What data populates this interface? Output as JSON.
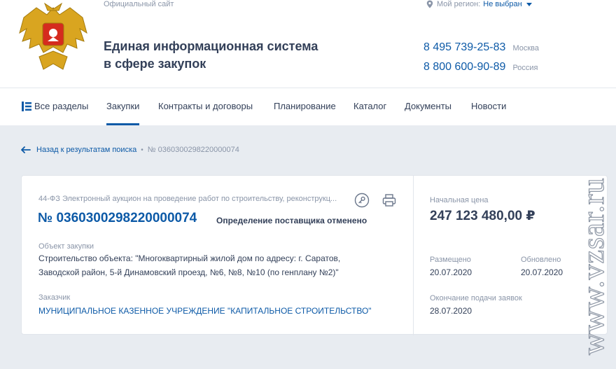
{
  "header": {
    "official_site": "Официальный сайт",
    "title_line1": "Единая информационная система",
    "title_line2": "в сфере закупок",
    "region_label": "Мой регион:",
    "region_value": "Не выбран",
    "phones": [
      {
        "number": "8 495 739-25-83",
        "city": "Москва"
      },
      {
        "number": "8 800 600-90-89",
        "city": "Россия"
      }
    ]
  },
  "nav": {
    "all_sections": "Все разделы",
    "items": [
      "Закупки",
      "Контракты и договоры",
      "Планирование",
      "Каталог",
      "Документы",
      "Новости"
    ],
    "active": "Закупки"
  },
  "breadcrumb": {
    "back": "Назад к результатам поиска",
    "separator": "•",
    "current": "№ 0360300298220000074"
  },
  "card": {
    "law": "44-ФЗ Электронный аукцион на проведение работ по строительству, реконструкц...",
    "number": "№ 0360300298220000074",
    "status": "Определение поставщика отменено",
    "object_label": "Объект закупки",
    "object_line1": "Строительство объекта: \"Многоквартирный жилой дом по адресу: г. Саратов,",
    "object_line2": "Заводской район, 5-й Динамовский проезд, №6, №8, №10 (по генплану №2)\"",
    "customer_label": "Заказчик",
    "customer": "МУНИЦИПАЛЬНОЕ КАЗЕННОЕ УЧРЕЖДЕНИЕ \"КАПИТАЛЬНОЕ СТРОИТЕЛЬСТВО\"",
    "price_label": "Начальная цена",
    "price": "247 123 480,00 ₽",
    "placed_label": "Размещено",
    "placed": "20.07.2020",
    "updated_label": "Обновлено",
    "updated": "20.07.2020",
    "deadline_label": "Окончание подачи заявок",
    "deadline": "28.07.2020"
  },
  "watermark": "www.vzsar.ru",
  "colors": {
    "accent": "#0d5aa7",
    "text": "#334059",
    "muted": "#8a95a8",
    "background": "#e8ecf1",
    "emblem_gold": "#d9a520",
    "emblem_red": "#d52b1e"
  },
  "icons": [
    "emblem-icon",
    "location-pin-icon",
    "caret-down-icon",
    "sections-icon",
    "arrow-left-icon",
    "link-icon",
    "print-icon"
  ]
}
